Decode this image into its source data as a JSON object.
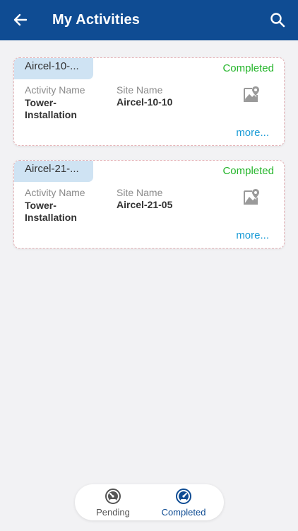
{
  "header": {
    "title": "My Activities"
  },
  "labels": {
    "activity_name": "Activity Name",
    "site_name": "Site Name",
    "more": "more..."
  },
  "activities": [
    {
      "tag": "Aircel-10-...",
      "status": "Completed",
      "activity_name": "Tower-Installation",
      "site_name": "Aircel-10-10"
    },
    {
      "tag": "Aircel-21-...",
      "status": "Completed",
      "activity_name": "Tower-Installation",
      "site_name": "Aircel-21-05"
    }
  ],
  "bottom_nav": {
    "items": [
      {
        "label": "Pending",
        "icon": "speedometer-icon",
        "active": false
      },
      {
        "label": "Completed",
        "icon": "speedometer-icon",
        "active": true
      }
    ]
  },
  "colors": {
    "appbar": "#0f4c93",
    "status_completed": "#24b52a",
    "more_link": "#1a9bd6",
    "tag_bg": "#cfe3f3"
  }
}
